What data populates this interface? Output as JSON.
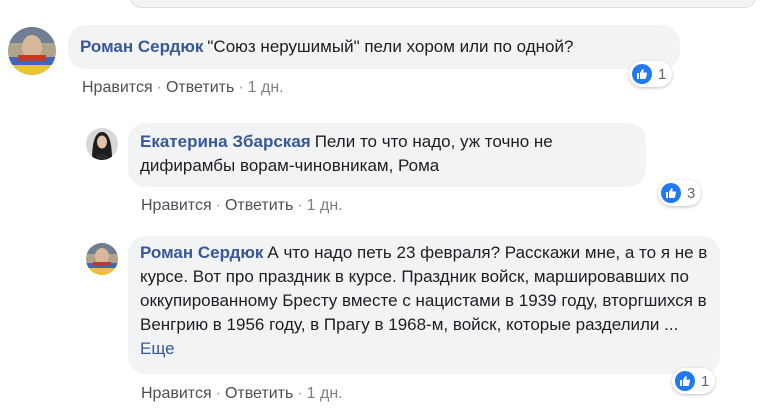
{
  "comments": [
    {
      "author": "Роман Сердюк",
      "text": "\"Союз нерушимый\" пели хором или по одной?",
      "more": "",
      "like_label": "Нравится",
      "reply_label": "Ответить",
      "time": "1 дн.",
      "reaction_count": "1",
      "avatar_icon": "avatar-flag-photo"
    },
    {
      "author": "Екатерина Збарская",
      "text": "Пели то что надо, уж точно не дифирамбы ворам-чиновникам, Рома",
      "more": "",
      "like_label": "Нравится",
      "reply_label": "Ответить",
      "time": "1 дн.",
      "reaction_count": "3",
      "avatar_icon": "avatar-woman-photo"
    },
    {
      "author": "Роман Сердюк",
      "text": "А что надо петь 23 февраля? Расскажи мне, а то я не в курсе. Вот про праздник в курсе. Праздник войск, маршировавших по оккупированному Бресту вместе с нацистами в 1939 году, вторгшихся в Венгрию в 1956 году, в Прагу в 1968-м, войск, которые разделили ...",
      "more": "Еще",
      "like_label": "Нравится",
      "reply_label": "Ответить",
      "time": "1 дн.",
      "reaction_count": "1",
      "avatar_icon": "avatar-flag-photo"
    }
  ],
  "colors": {
    "author": "#385898",
    "bubble": "#f2f3f5",
    "like_blue": "#2078f4",
    "action_text": "#4b4f56"
  }
}
